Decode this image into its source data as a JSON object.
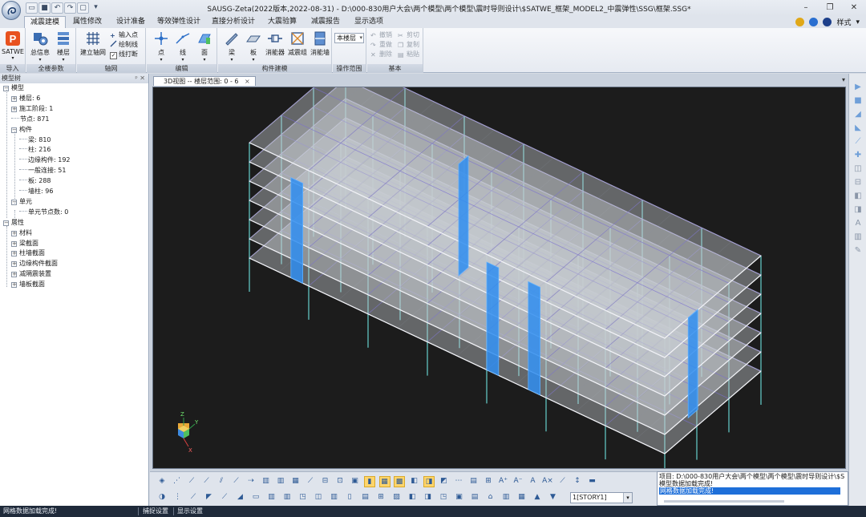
{
  "window": {
    "title": "SAUSG-Zeta(2022版本,2022-08-31) - D:\\000-830用户大会\\两个模型\\两个模型\\震时导则设计\\$SATWE_框架_MODEL2_中震弹性\\SSG\\框架.SSG*",
    "controls": [
      "–",
      "❐",
      "✕"
    ]
  },
  "ribbon_tabs": [
    {
      "label": "减震建模",
      "active": true
    },
    {
      "label": "属性修改",
      "active": false
    },
    {
      "label": "设计准备",
      "active": false
    },
    {
      "label": "等效弹性设计",
      "active": false
    },
    {
      "label": "直接分析设计",
      "active": false
    },
    {
      "label": "大震验算",
      "active": false
    },
    {
      "label": "减震报告",
      "active": false
    },
    {
      "label": "显示选项",
      "active": false
    }
  ],
  "tab_right": {
    "style_label": "样式"
  },
  "ribbon": {
    "groups": {
      "import": "导入",
      "global": "全楼参数",
      "axis": "轴网",
      "edit": "编辑",
      "member": "构件建模",
      "scope": "操作范围",
      "basic": "基本"
    },
    "buttons": {
      "satwe": "SATWE",
      "general_info": "总信息",
      "floors": "楼层",
      "build_axis": "建立轴网",
      "input_point": "输入点",
      "draw_line": "绘制线",
      "break_line": "线打断",
      "point": "点",
      "line": "线",
      "face": "面",
      "beam": "梁",
      "slab": "板",
      "damper": "消能器",
      "damper_group": "减震组",
      "damper_wall": "消能墙",
      "undo": "撤销",
      "redo": "重做",
      "delete": "删除",
      "cut": "剪切",
      "copy": "复制",
      "paste": "粘贴"
    },
    "scope_select": "本楼层"
  },
  "model_tree": {
    "header": "模型树",
    "nodes": [
      {
        "label": "模型",
        "sign": "−"
      },
      {
        "label": "楼层: 6",
        "sign": "+"
      },
      {
        "label": "施工阶段: 1",
        "sign": "+"
      },
      {
        "label": "节点:   871",
        "sign": ""
      },
      {
        "label": "构件",
        "sign": "−"
      },
      {
        "label": "梁: 810",
        "sign": ""
      },
      {
        "label": "柱: 216",
        "sign": ""
      },
      {
        "label": "边缘构件: 192",
        "sign": ""
      },
      {
        "label": "一般连接: 51",
        "sign": ""
      },
      {
        "label": "板: 288",
        "sign": ""
      },
      {
        "label": "墙柱: 96",
        "sign": ""
      },
      {
        "label": "单元",
        "sign": "−"
      },
      {
        "label": "单元节点数: 0",
        "sign": ""
      },
      {
        "label": "属性",
        "sign": "−"
      },
      {
        "label": "材料",
        "sign": "+"
      },
      {
        "label": "梁截面",
        "sign": "+"
      },
      {
        "label": "柱墙截面",
        "sign": "+"
      },
      {
        "label": "边缘构件截面",
        "sign": "+"
      },
      {
        "label": "减隔震装置",
        "sign": "+"
      },
      {
        "label": "墙板截面",
        "sign": "+"
      }
    ]
  },
  "document": {
    "tab_label": "3D视图 -- 楼层范围: 0 - 6",
    "tab_close": "×",
    "axis_labels": {
      "z": "Z",
      "y": "Y",
      "x": "X"
    }
  },
  "bottom_toolbar": {
    "story_select": "1[STORY1]"
  },
  "output": {
    "lines": [
      "项目: D:\\000-830用户大会\\两个模型\\两个模型\\震时导则设计\\$S",
      "模型数据加载完成!",
      "网格数据加载完成!"
    ]
  },
  "statusbar": {
    "message": "网格数据加载完成!",
    "snap_settings": "捕捉设置",
    "display_settings": "显示设置"
  },
  "colors": {
    "viewport_bg": "#1c1c1c",
    "slab_fill": "#c8ccd2",
    "column": "#6fe3e0",
    "wall_blue": "#2f8df0",
    "accent": "#1e6fd9"
  }
}
